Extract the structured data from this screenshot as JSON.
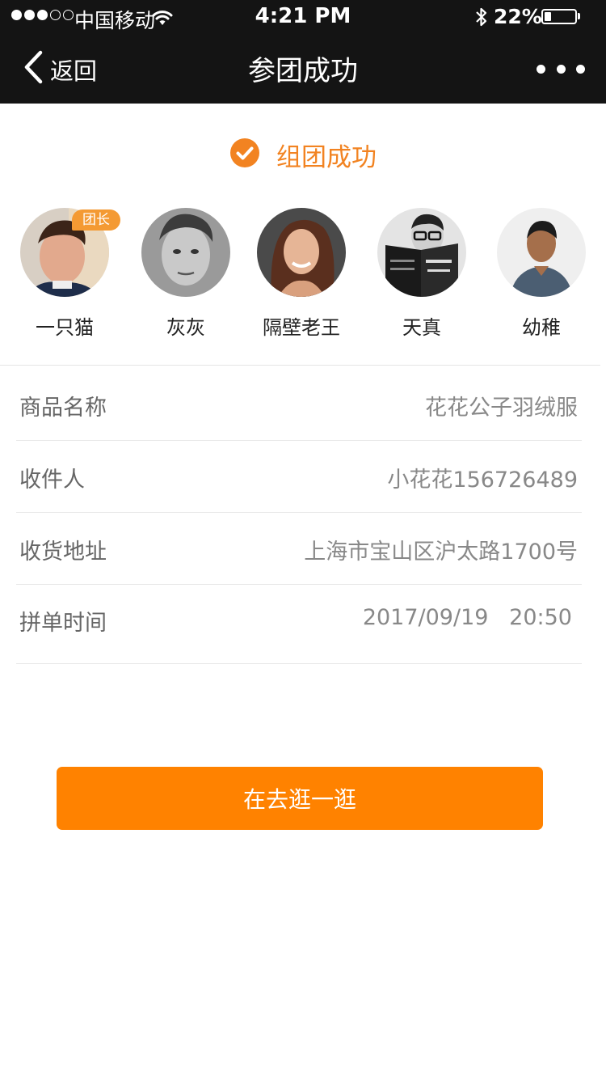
{
  "status_bar": {
    "carrier": "中国移动",
    "time": "4:21 PM",
    "battery_percent": "22%",
    "battery_level": 0.22,
    "signal_bars_filled": 3,
    "signal_bars_total": 5
  },
  "nav": {
    "back_label": "返回",
    "title": "参团成功",
    "icons": {
      "back": "chevron-left-icon",
      "more": "more-dots-icon"
    }
  },
  "result": {
    "icon": "check-circle-icon",
    "text": "组团成功",
    "color": "#f28321"
  },
  "members": [
    {
      "name": "一只猫",
      "badge": "团长"
    },
    {
      "name": "灰灰"
    },
    {
      "name": "隔壁老王"
    },
    {
      "name": "天真"
    },
    {
      "name": "幼稚"
    }
  ],
  "details": [
    {
      "label": "商品名称",
      "value": "花花公子羽绒服"
    },
    {
      "label": "收件人",
      "value": "小花花156726489"
    },
    {
      "label": "收货地址",
      "value": "上海市宝山区沪太路1700号"
    },
    {
      "label": "拼单时间",
      "value": "2017/09/19   20:50"
    }
  ],
  "action_button": {
    "label": "在去逛一逛",
    "color": "#ff8200"
  }
}
